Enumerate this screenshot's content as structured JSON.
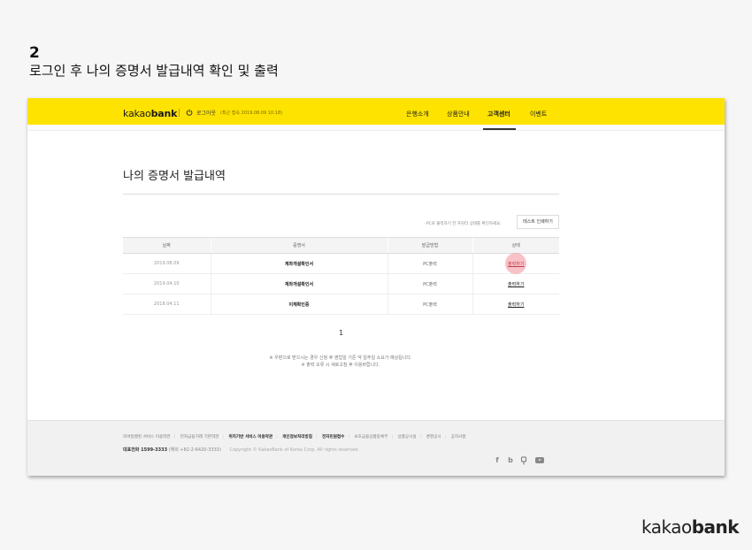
{
  "step": {
    "number": "2",
    "title": "로그인 후 나의 증명서 발급내역 확인 및 출력"
  },
  "header": {
    "logo_light": "kakao",
    "logo_bold": "bank",
    "logout": "로그아웃",
    "last_login": "(최근 접속 2019.08.09 10:18)",
    "nav": [
      "은행소개",
      "상품안내",
      "고객센터",
      "이벤트"
    ],
    "active_nav": "고객센터",
    "brand_color": "#ffe300"
  },
  "page": {
    "title": "나의 증명서 발급내역",
    "print_note": "· PC로 출력하기 전 프린터 상태를 확인하세요.",
    "print_test_button": "테스트 인쇄하기"
  },
  "table": {
    "headers": [
      "날짜",
      "증명서",
      "발급방법",
      "상태"
    ],
    "rows": [
      {
        "date": "2019.08.09",
        "cert": "계좌개설확인서",
        "method": "PC출력",
        "status": "출력하기"
      },
      {
        "date": "2019.04.10",
        "cert": "계좌개설확인서",
        "method": "PC출력",
        "status": "출력하기"
      },
      {
        "date": "2018.04.11",
        "cert": "이체확인증",
        "method": "PC출력",
        "status": "출력하기"
      }
    ]
  },
  "pager": {
    "current": "1"
  },
  "notices": [
    "※ 우편으로 받으시는 경우 신청 후 영업일 기준 약 일주일 소요가 예상됩니다.",
    "※ 출력 오류 시 새로고침 후 이용바랍니다."
  ],
  "footer": {
    "links": [
      {
        "label": "모바일뱅킹 서비스 이용약관",
        "bold": false
      },
      {
        "label": "전자금융거래 기본약관",
        "bold": false
      },
      {
        "label": "위치기반 서비스 이용약관",
        "bold": true
      },
      {
        "label": "개인정보처리방침",
        "bold": true
      },
      {
        "label": "전자민원접수",
        "bold": true
      },
      {
        "label": "보호금융상품등록부",
        "bold": false
      },
      {
        "label": "상품공시실",
        "bold": false
      },
      {
        "label": "경영공시",
        "bold": false
      },
      {
        "label": "공지사항",
        "bold": false
      }
    ],
    "phone_label": "대표전화 1599-3333",
    "phone_sub": "(해외 +82-2-6420-3333)",
    "copyright": "Copyright © KakaoBank of Korea Corp. All rights reserved.",
    "social_icons": [
      "facebook-icon",
      "blog-icon",
      "podcast-icon",
      "youtube-icon"
    ]
  },
  "brand_watermark": {
    "light": "kakao",
    "bold": "bank"
  }
}
